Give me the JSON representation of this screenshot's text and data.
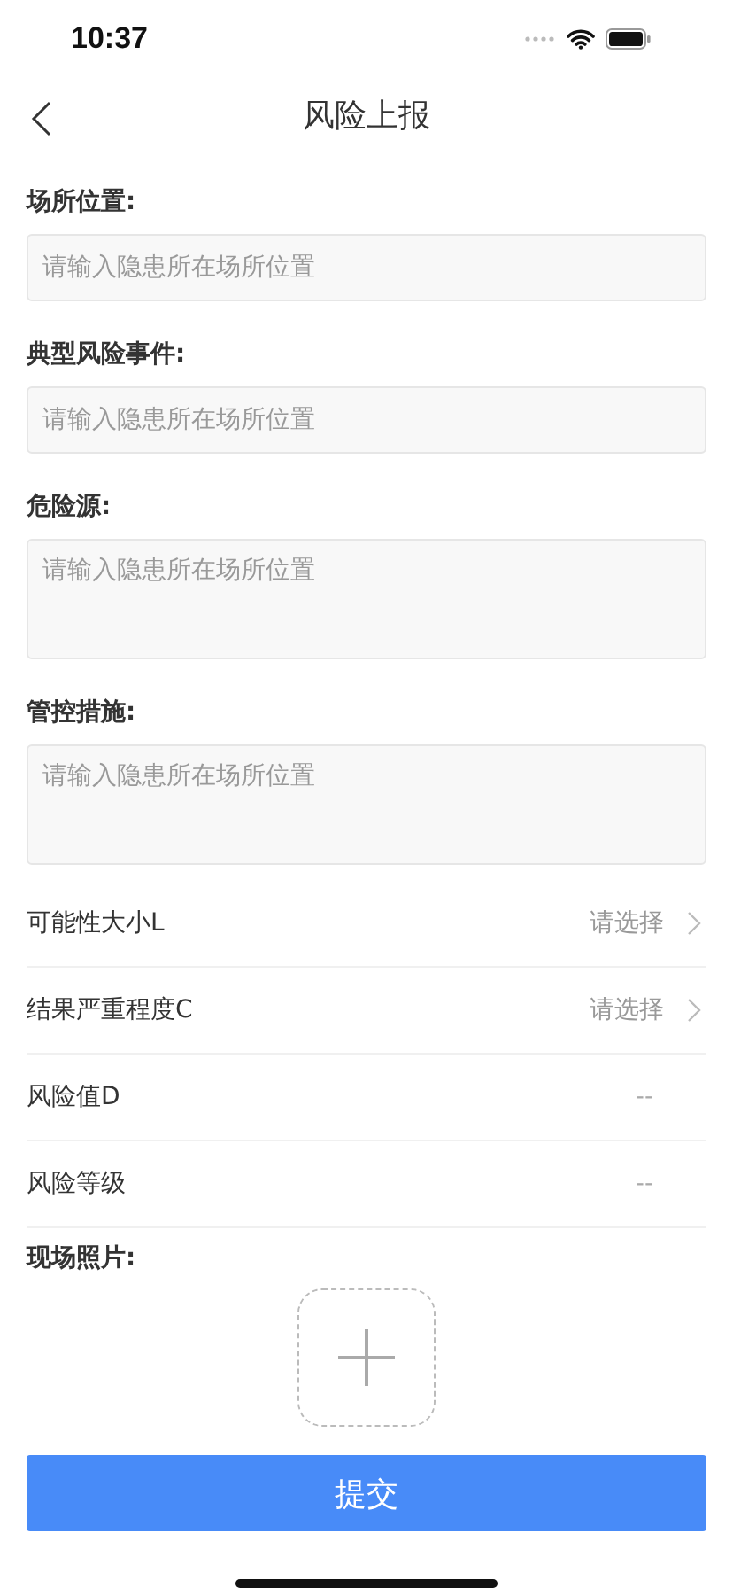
{
  "status_bar": {
    "time": "10:37"
  },
  "nav": {
    "title": "风险上报"
  },
  "fields": [
    {
      "label": "场所位置:",
      "kind": "single",
      "placeholder": "请输入隐患所在场所位置"
    },
    {
      "label": "典型风险事件:",
      "kind": "single",
      "placeholder": "请输入隐患所在场所位置"
    },
    {
      "label": "危险源:",
      "kind": "multi",
      "placeholder": "请输入隐患所在场所位置"
    },
    {
      "label": "管控措施:",
      "kind": "multi",
      "placeholder": "请输入隐患所在场所位置"
    }
  ],
  "rows": [
    {
      "label": "可能性大小L",
      "kind": "select",
      "value": "请选择"
    },
    {
      "label": "结果严重程度C",
      "kind": "select",
      "value": "请选择"
    },
    {
      "label": "风险值D",
      "kind": "display",
      "value": "--"
    },
    {
      "label": "风险等级",
      "kind": "display",
      "value": "--"
    }
  ],
  "photos": {
    "label": "现场照片:"
  },
  "submit": {
    "label": "提交"
  }
}
